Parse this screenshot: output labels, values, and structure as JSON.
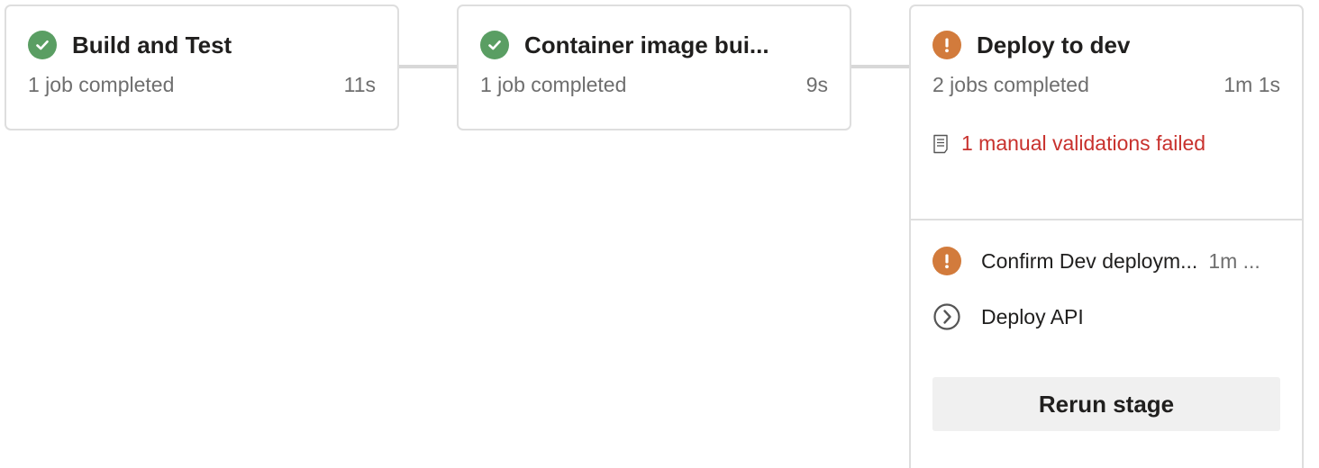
{
  "stages": [
    {
      "title": "Build and Test",
      "status": "succeeded",
      "status_icon": "check-circle-icon",
      "jobs_summary": "1 job completed",
      "duration": "11s"
    },
    {
      "title": "Container image bui...",
      "status": "succeeded",
      "status_icon": "check-circle-icon",
      "jobs_summary": "1 job completed",
      "duration": "9s"
    },
    {
      "title": "Deploy to dev",
      "status": "warning",
      "status_icon": "exclamation-circle-icon",
      "jobs_summary": "2 jobs completed",
      "duration": "1m 1s",
      "validation_message": "1 manual validations failed",
      "jobs": [
        {
          "name": "Confirm Dev deploym...",
          "duration": "1m ...",
          "icon": "exclamation-circle-icon"
        },
        {
          "name": "Deploy API",
          "duration": "",
          "icon": "chevron-right-circle-icon"
        }
      ],
      "rerun_label": "Rerun stage"
    }
  ],
  "colors": {
    "success": "#5a9e63",
    "warning": "#d27b3c",
    "error_text": "#c8312d",
    "muted_text": "#6e6e6e",
    "border": "#dedede",
    "button_bg": "#f0f0f0"
  }
}
